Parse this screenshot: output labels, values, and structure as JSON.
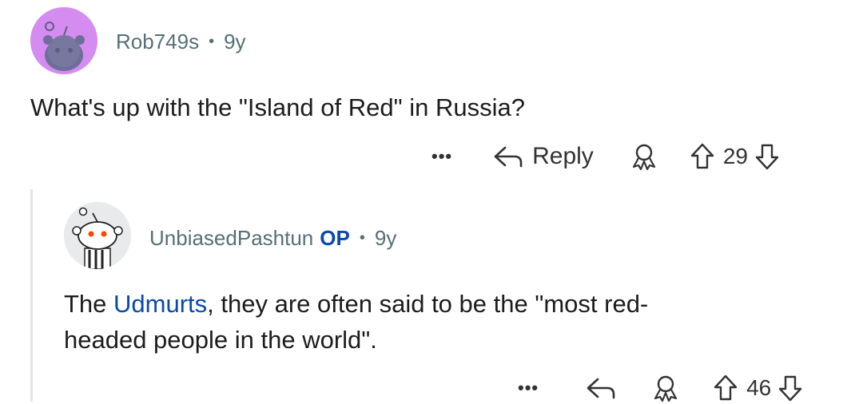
{
  "comment1": {
    "username": "Rob749s",
    "separator": "•",
    "age": "9y",
    "text": "What's up with the \"Island of Red\" in Russia?",
    "actions": {
      "more": "•••",
      "reply_label": "Reply",
      "score": "29"
    }
  },
  "comment2": {
    "username": "UnbiasedPashtun",
    "op_badge": "OP",
    "separator": "•",
    "age": "9y",
    "text_link": "Udmurts",
    "text_before": "The ",
    "text_after": ", they are often said to be the \"most red-",
    "text_line2": "headed people in the world\".",
    "actions": {
      "more": "•••",
      "score": "46"
    }
  },
  "colors": {
    "meta_gray": "#576f76",
    "link_blue": "#0a49a8",
    "avatar1_bg": "#d48cf0",
    "avatar2_bg": "#e8eaec"
  }
}
